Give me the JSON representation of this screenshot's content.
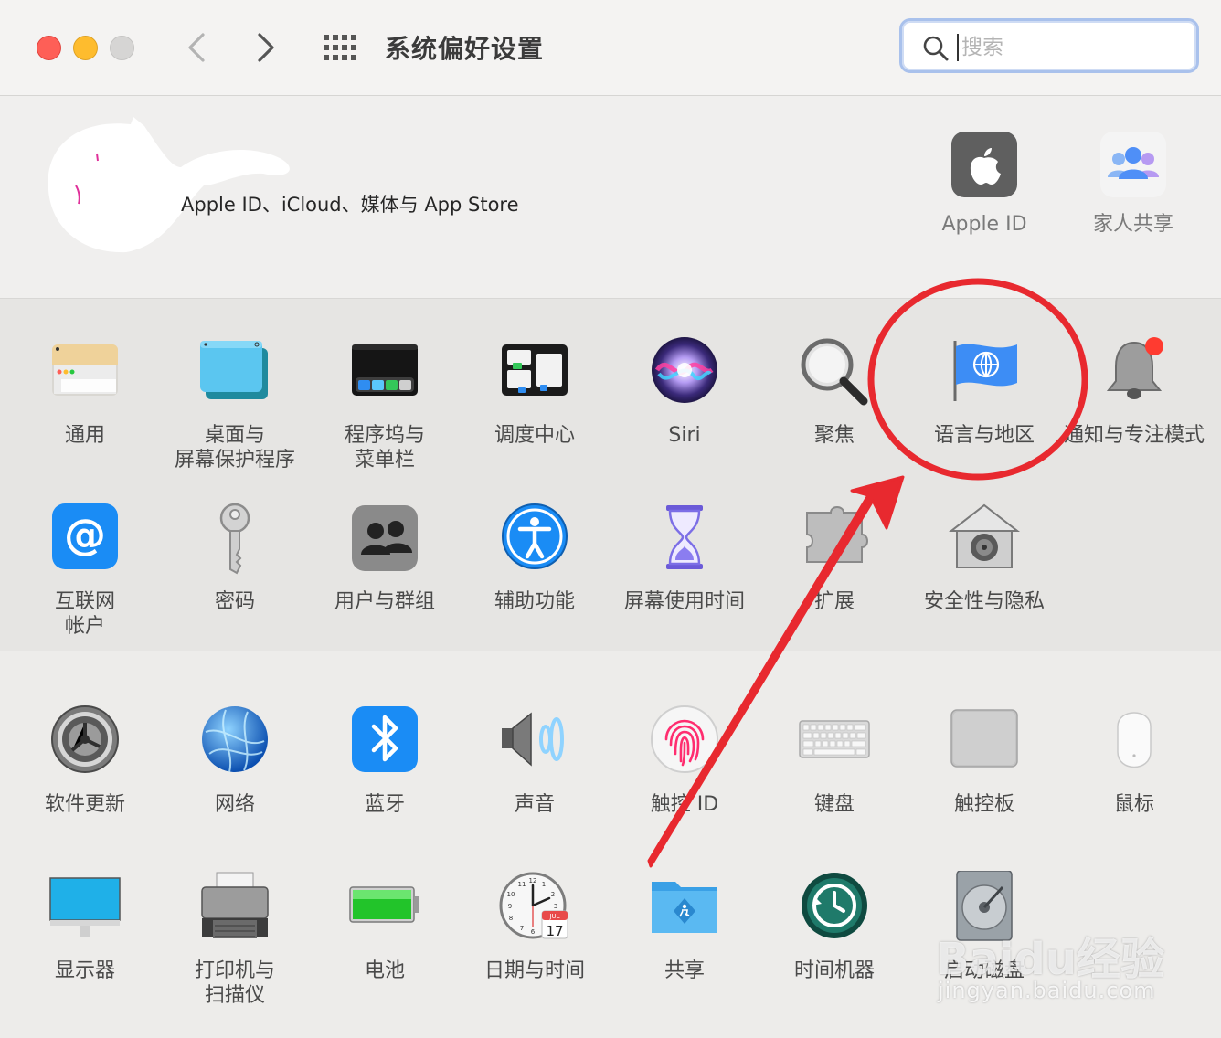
{
  "window": {
    "title": "系统偏好设置",
    "search_placeholder": "搜索"
  },
  "account": {
    "label": "Apple ID、iCloud、媒体与 App Store",
    "items": [
      {
        "label": "Apple ID",
        "icon": "apple-logo-icon"
      },
      {
        "label": "家人共享",
        "icon": "family-sharing-icon"
      }
    ]
  },
  "row1": [
    {
      "label": "通用",
      "icon": "general-icon"
    },
    {
      "label": "桌面与\n屏幕保护程序",
      "icon": "desktop-screensaver-icon"
    },
    {
      "label": "程序坞与\n菜单栏",
      "icon": "dock-menubar-icon"
    },
    {
      "label": "调度中心",
      "icon": "mission-control-icon"
    },
    {
      "label": "Siri",
      "icon": "siri-icon"
    },
    {
      "label": "聚焦",
      "icon": "spotlight-icon"
    },
    {
      "label": "语言与地区",
      "icon": "language-region-icon"
    },
    {
      "label": "通知与专注模式",
      "icon": "notifications-icon"
    }
  ],
  "row2": [
    {
      "label": "互联网\n帐户",
      "icon": "internet-accounts-icon"
    },
    {
      "label": "密码",
      "icon": "passwords-key-icon"
    },
    {
      "label": "用户与群组",
      "icon": "users-groups-icon"
    },
    {
      "label": "辅助功能",
      "icon": "accessibility-icon"
    },
    {
      "label": "屏幕使用时间",
      "icon": "screen-time-icon"
    },
    {
      "label": "扩展",
      "icon": "extensions-icon"
    },
    {
      "label": "安全性与隐私",
      "icon": "security-privacy-icon"
    }
  ],
  "row3": [
    {
      "label": "软件更新",
      "icon": "software-update-icon"
    },
    {
      "label": "网络",
      "icon": "network-icon"
    },
    {
      "label": "蓝牙",
      "icon": "bluetooth-icon"
    },
    {
      "label": "声音",
      "icon": "sound-icon"
    },
    {
      "label": "触控 ID",
      "icon": "touch-id-icon"
    },
    {
      "label": "键盘",
      "icon": "keyboard-icon"
    },
    {
      "label": "触控板",
      "icon": "trackpad-icon"
    },
    {
      "label": "鼠标",
      "icon": "mouse-icon"
    }
  ],
  "row4": [
    {
      "label": "显示器",
      "icon": "displays-icon"
    },
    {
      "label": "打印机与\n扫描仪",
      "icon": "printers-scanners-icon"
    },
    {
      "label": "电池",
      "icon": "battery-icon"
    },
    {
      "label": "日期与时间",
      "icon": "date-time-icon"
    },
    {
      "label": "共享",
      "icon": "sharing-icon"
    },
    {
      "label": "时间机器",
      "icon": "time-machine-icon"
    },
    {
      "label": "启动磁盘",
      "icon": "startup-disk-icon"
    }
  ],
  "date_icon": {
    "month": "JUL",
    "day": "17"
  },
  "annotation": {
    "color": "#e8292f"
  },
  "watermark": {
    "brand": "Baidu经验",
    "url": "jingyan.baidu.com"
  }
}
